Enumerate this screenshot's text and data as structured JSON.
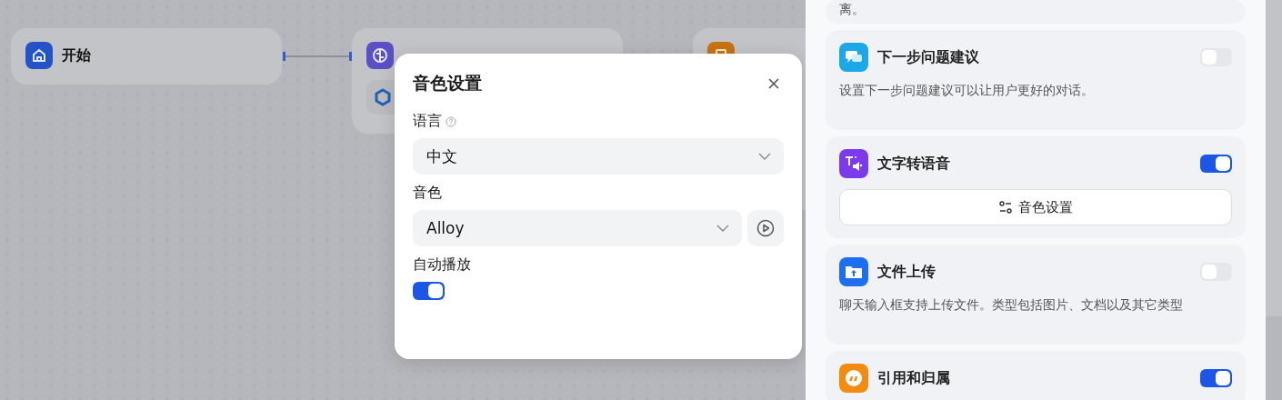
{
  "canvas": {
    "nodes": [
      {
        "kind": "start",
        "title": "开始"
      },
      {
        "kind": "llm"
      },
      {
        "kind": "reply"
      }
    ]
  },
  "dialog": {
    "title": "音色设置",
    "fields": [
      {
        "kind": "select",
        "label": "语言",
        "help": true,
        "value": "中文"
      },
      {
        "kind": "select",
        "label": "音色",
        "value": "Alloy",
        "preview": true
      },
      {
        "kind": "switch",
        "label": "自动播放",
        "on": true
      }
    ]
  },
  "panel": {
    "top_text": "离。",
    "features": [
      {
        "kind": "chat",
        "color": "#1ba7e8",
        "title": "下一步问题建议",
        "on": false,
        "description": "设置下一步问题建议可以让用户更好的对话。"
      },
      {
        "kind": "tts",
        "color": "#7c3aed",
        "title": "文字转语音",
        "on": true,
        "button": "音色设置"
      },
      {
        "kind": "upload",
        "color": "#1d6ff2",
        "title": "文件上传",
        "on": false,
        "description": "聊天输入框支持上传文件。类型包括图片、文档以及其它类型"
      },
      {
        "kind": "quote",
        "color": "#f28c0f",
        "title": "引用和归属",
        "on": true
      }
    ]
  }
}
